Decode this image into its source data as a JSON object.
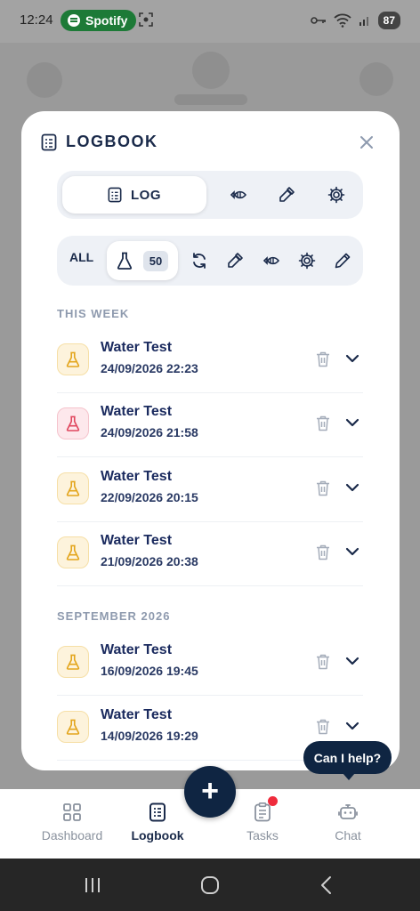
{
  "status_bar": {
    "time": "12:24",
    "app_pill": "Spotify",
    "battery": "87"
  },
  "modal": {
    "title": "LOGBOOK",
    "view_tabs": {
      "active_label": "LOG"
    },
    "filter_tabs": {
      "all_label": "ALL",
      "count": "50"
    },
    "sections": [
      {
        "label": "THIS WEEK",
        "entries": [
          {
            "title": "Water Test",
            "date": "24/09/2026 22:23",
            "tone": "amber"
          },
          {
            "title": "Water Test",
            "date": "24/09/2026 21:58",
            "tone": "red"
          },
          {
            "title": "Water Test",
            "date": "22/09/2026 20:15",
            "tone": "amber"
          },
          {
            "title": "Water Test",
            "date": "21/09/2026 20:38",
            "tone": "amber"
          }
        ]
      },
      {
        "label": "SEPTEMBER 2026",
        "entries": [
          {
            "title": "Water Test",
            "date": "16/09/2026 19:45",
            "tone": "amber"
          },
          {
            "title": "Water Test",
            "date": "14/09/2026 19:29",
            "tone": "amber"
          }
        ]
      }
    ]
  },
  "help_bubble": "Can I help?",
  "bottom_nav": {
    "items": [
      {
        "label": "Dashboard",
        "icon": "grid-icon"
      },
      {
        "label": "Logbook",
        "icon": "logbook-icon"
      },
      {
        "label": "Tasks",
        "icon": "tasks-icon"
      },
      {
        "label": "Chat",
        "icon": "robot-icon"
      }
    ],
    "active": "Logbook"
  },
  "colors": {
    "navy": "#0f2542",
    "amber_badge": "#fdf3dc",
    "red_badge": "#fde8ec",
    "notification": "#ef2b3c"
  }
}
